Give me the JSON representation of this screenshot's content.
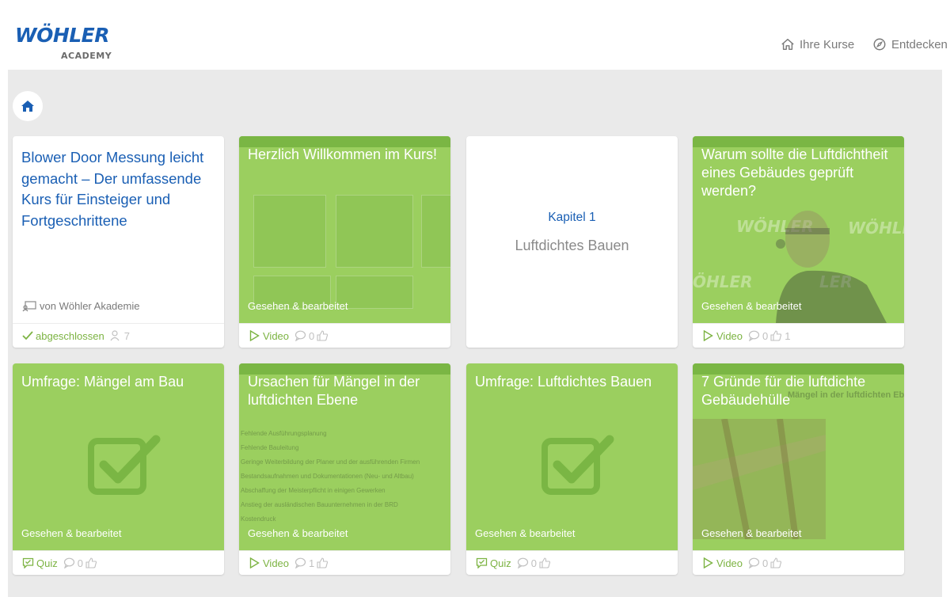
{
  "brand": {
    "name": "WÖHLER",
    "sub": "ACADEMY",
    "color": "#1a5fb4"
  },
  "nav": {
    "courses": "Ihre Kurse",
    "discover": "Entdecken"
  },
  "intro": {
    "title": "Blower Door Messung leicht gemacht – Der umfassende Kurs für Einsteiger und Fortgeschrittene",
    "author": "von Wöhler Akademie",
    "status": "abgeschlossen",
    "participants": "7"
  },
  "chapter": {
    "label": "Kapitel 1",
    "name": "Luftdichtes Bauen"
  },
  "seen_label": "Gesehen & bearbeitet",
  "cards": [
    {
      "title": "Herzlich Willkommen im Kurs!",
      "type": "Video",
      "comments": "0",
      "likes": ""
    },
    {
      "title": "Warum sollte die Luftdichtheit eines Gebäudes geprüft werden?",
      "type": "Video",
      "comments": "0",
      "likes": "1"
    },
    {
      "title": "Umfrage: Mängel am Bau",
      "type": "Quiz",
      "comments": "0",
      "likes": ""
    },
    {
      "title": "Ursachen für Mängel in der luftdichten Ebene",
      "type": "Video",
      "comments": "1",
      "likes": ""
    },
    {
      "title": "Umfrage: Luftdichtes Bauen",
      "type": "Quiz",
      "comments": "0",
      "likes": ""
    },
    {
      "title": "7 Gründe für die luftdichte Gebäudehülle",
      "type": "Video",
      "comments": "0",
      "likes": ""
    }
  ],
  "thumb_text": {
    "wohler_watermark": "WÖHLER",
    "ohler_watermark": "ÖHLER",
    "ler_watermark": "LER",
    "slide_header": "Mängel in der luftdichten Ebene- Ursachen und Folgen",
    "causes": [
      "Fehlende Ausführungsplanung",
      "Fehlende Bauleitung",
      "Geringe Weiterbildung der Planer und der ausführenden Firmen",
      "Bestandsaufnahmen und Dokumentationen (Neu- und Altbau)",
      "Abschaffung der Meisterpflicht in einigen Gewerken",
      "Anstieg der ausländischen Bauunternehmen in der BRD",
      "Kostendruck"
    ]
  },
  "colors": {
    "accent_green": "#7cb342",
    "card_green": "#9bcf5f",
    "link_blue": "#1a5fb4"
  },
  "icons": {
    "home": "home-icon",
    "compass": "compass-icon",
    "author": "teacher-icon",
    "check": "check-icon",
    "users": "users-icon",
    "play": "play-icon",
    "quiz": "quiz-icon",
    "comment": "comment-icon",
    "like": "thumbs-up-icon"
  }
}
